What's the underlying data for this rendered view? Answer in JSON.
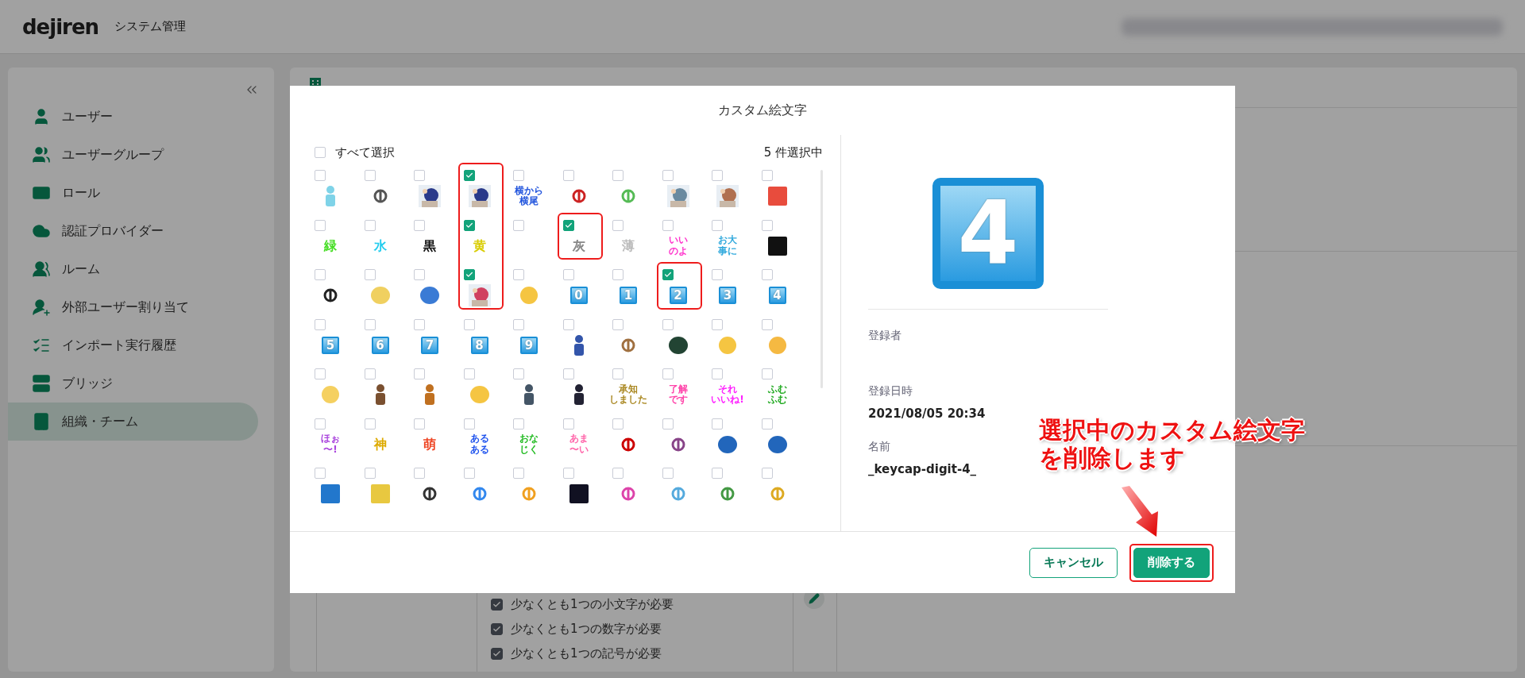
{
  "header": {
    "logo": "dejiren",
    "title": "システム管理"
  },
  "sidebar": {
    "items": [
      {
        "label": "ユーザー",
        "selected": false
      },
      {
        "label": "ユーザーグループ",
        "selected": false
      },
      {
        "label": "ロール",
        "selected": false
      },
      {
        "label": "認証プロバイダー",
        "selected": false
      },
      {
        "label": "ルーム",
        "selected": false
      },
      {
        "label": "外部ユーザー割り当て",
        "selected": false
      },
      {
        "label": "インポート実行履歴",
        "selected": false
      },
      {
        "label": "ブリッジ",
        "selected": false
      },
      {
        "label": "組織・チーム",
        "selected": true
      }
    ]
  },
  "policies": [
    {
      "label": "少なくとも1つの小文字が必要",
      "checked": true
    },
    {
      "label": "少なくとも1つの数字が必要",
      "checked": true
    },
    {
      "label": "少なくとも1つの記号が必要",
      "checked": true
    }
  ],
  "modal": {
    "title": "カスタム絵文字",
    "select_all": {
      "label": "すべて選択",
      "checked": false
    },
    "selection_count": "5 件選択中",
    "emojis": [
      {
        "kind": "figure",
        "color": "#7fd3e8",
        "checked": false
      },
      {
        "kind": "logo",
        "color": "#555555",
        "checked": false
      },
      {
        "kind": "picture",
        "color": "#2a3a8a",
        "checked": false
      },
      {
        "kind": "picture",
        "color": "#2a3a8a",
        "checked": true,
        "highlighted": true
      },
      {
        "kind": "text",
        "lines": [
          "横から",
          "横尾"
        ],
        "color": "#2255dd",
        "checked": false
      },
      {
        "kind": "logo",
        "color": "#cc2222",
        "checked": false
      },
      {
        "kind": "logo",
        "color": "#55bb55",
        "checked": false
      },
      {
        "kind": "picture",
        "color": "#6a8aa0",
        "checked": false
      },
      {
        "kind": "picture",
        "color": "#b07050",
        "checked": false
      },
      {
        "kind": "square",
        "color": "#e84c3d",
        "checked": false
      },
      {
        "kind": "text",
        "lines": [
          "緑"
        ],
        "color": "#44dd22",
        "checked": false
      },
      {
        "kind": "text",
        "lines": [
          "水"
        ],
        "color": "#22ccee",
        "checked": false
      },
      {
        "kind": "text",
        "lines": [
          "黒"
        ],
        "color": "#111111",
        "checked": false
      },
      {
        "kind": "text",
        "lines": [
          "黄"
        ],
        "color": "#d8cc00",
        "checked": true,
        "highlighted": true
      },
      {
        "checked": false
      },
      {
        "kind": "text",
        "lines": [
          "灰"
        ],
        "color": "#888888",
        "checked": true,
        "highlighted": true
      },
      {
        "kind": "text",
        "lines": [
          "薄"
        ],
        "color": "#bbbbbb",
        "checked": false
      },
      {
        "kind": "text",
        "lines": [
          "いい",
          "のよ"
        ],
        "color": "#ff33cc",
        "checked": false
      },
      {
        "kind": "text",
        "lines": [
          "お大",
          "事に"
        ],
        "color": "#33aadd",
        "checked": false
      },
      {
        "kind": "square",
        "color": "#111111",
        "checked": false
      },
      {
        "kind": "logo",
        "color": "#222222",
        "checked": false
      },
      {
        "kind": "blob",
        "color": "#f0d060",
        "checked": false
      },
      {
        "kind": "blob",
        "color": "#3a7bd5",
        "checked": false
      },
      {
        "kind": "picture",
        "color": "#d04060",
        "checked": true,
        "highlighted": true
      },
      {
        "kind": "face",
        "color": "#f5c542",
        "checked": false
      },
      {
        "kind": "keycap",
        "label": "0",
        "checked": false
      },
      {
        "kind": "keycap",
        "label": "1",
        "checked": false
      },
      {
        "kind": "keycap",
        "label": "2",
        "checked": true,
        "highlighted": true
      },
      {
        "kind": "keycap",
        "label": "3",
        "checked": false
      },
      {
        "kind": "keycap",
        "label": "4",
        "checked": false
      },
      {
        "kind": "keycap",
        "label": "5",
        "checked": false
      },
      {
        "kind": "keycap",
        "label": "6",
        "checked": false
      },
      {
        "kind": "keycap",
        "label": "7",
        "checked": false
      },
      {
        "kind": "keycap",
        "label": "8",
        "checked": false
      },
      {
        "kind": "keycap",
        "label": "9",
        "checked": false
      },
      {
        "kind": "figure",
        "color": "#3355aa",
        "checked": false
      },
      {
        "kind": "logo",
        "color": "#a07040",
        "checked": false
      },
      {
        "kind": "blob",
        "color": "#224433",
        "checked": false
      },
      {
        "kind": "face",
        "color": "#f5c542",
        "checked": false
      },
      {
        "kind": "face",
        "color": "#f5b942",
        "checked": false
      },
      {
        "kind": "face",
        "color": "#f5d060",
        "checked": false
      },
      {
        "kind": "figure",
        "color": "#7a5030",
        "checked": false
      },
      {
        "kind": "figure",
        "color": "#c07020",
        "checked": false
      },
      {
        "kind": "blob",
        "color": "#f5c542",
        "checked": false
      },
      {
        "kind": "figure",
        "color": "#445566",
        "checked": false
      },
      {
        "kind": "figure",
        "color": "#222233",
        "checked": false
      },
      {
        "kind": "text",
        "lines": [
          "承知",
          "しました"
        ],
        "color": "#aa8822",
        "checked": false
      },
      {
        "kind": "text",
        "lines": [
          "了解",
          "です"
        ],
        "color": "#ff44aa",
        "checked": false
      },
      {
        "kind": "text",
        "lines": [
          "それ",
          "いいね!"
        ],
        "color": "#ff22ff",
        "checked": false
      },
      {
        "kind": "text",
        "lines": [
          "ふむ",
          "ふむ"
        ],
        "color": "#22aa22",
        "checked": false
      },
      {
        "kind": "text",
        "lines": [
          "ほぉ",
          "〜!"
        ],
        "color": "#aa44dd",
        "checked": false
      },
      {
        "kind": "text",
        "lines": [
          "神"
        ],
        "color": "#ddaa00",
        "checked": false
      },
      {
        "kind": "text",
        "lines": [
          "萌"
        ],
        "color": "#ee4422",
        "checked": false
      },
      {
        "kind": "text",
        "lines": [
          "ある",
          "ある"
        ],
        "color": "#2255ee",
        "checked": false
      },
      {
        "kind": "text",
        "lines": [
          "おな",
          "じく"
        ],
        "color": "#22bb22",
        "checked": false
      },
      {
        "kind": "text",
        "lines": [
          "あま",
          "〜い"
        ],
        "color": "#ff66aa",
        "checked": false
      },
      {
        "kind": "logo",
        "color": "#cc0000",
        "checked": false
      },
      {
        "kind": "logo",
        "color": "#884488",
        "checked": false
      },
      {
        "kind": "blob",
        "color": "#2266bb",
        "checked": false
      },
      {
        "kind": "blob",
        "color": "#2266bb",
        "checked": false
      },
      {
        "kind": "square",
        "color": "#2277cc",
        "checked": false
      },
      {
        "kind": "square",
        "color": "#e8c840",
        "checked": false
      },
      {
        "kind": "logo",
        "color": "#333333",
        "checked": false
      },
      {
        "kind": "logo",
        "color": "#3388ee",
        "checked": false
      },
      {
        "kind": "logo",
        "color": "#f0a020",
        "checked": false
      },
      {
        "kind": "square",
        "color": "#111122",
        "checked": false
      },
      {
        "kind": "logo",
        "color": "#dd44aa",
        "checked": false
      },
      {
        "kind": "logo",
        "color": "#55aadd",
        "checked": false
      },
      {
        "kind": "logo",
        "color": "#449944",
        "checked": false
      },
      {
        "kind": "logo",
        "color": "#ddaa22",
        "checked": false
      }
    ],
    "preview": {
      "label": "4"
    },
    "details": [
      {
        "label": "登録者"
      },
      {
        "label": "登録日時",
        "value": "2021/08/05 20:34"
      },
      {
        "label": "名前",
        "value": "_keycap-digit-4_"
      }
    ],
    "buttons": [
      {
        "label": "キャンセル",
        "kind": "secondary",
        "highlighted": false
      },
      {
        "label": "削除する",
        "kind": "primary",
        "highlighted": true
      }
    ]
  },
  "annotation": {
    "lines": [
      "選択中のカスタム絵文字",
      "を削除します"
    ]
  }
}
